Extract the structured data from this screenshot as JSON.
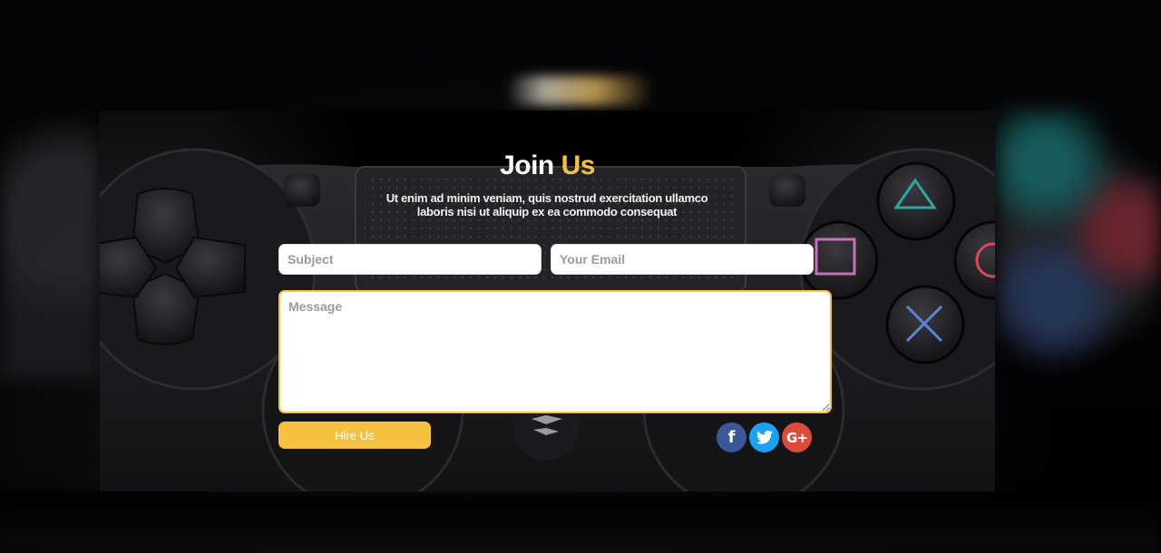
{
  "section": {
    "title_part1": "Join",
    "title_part2": "Us",
    "description": "Ut enim ad minim veniam, quis nostrud exercitation ullamco laboris nisi ut aliquip ex ea commodo consequat"
  },
  "form": {
    "subject_placeholder": "Subject",
    "email_placeholder": "Your Email",
    "message_placeholder": "Message",
    "submit_label": "Hire Us"
  },
  "social": [
    {
      "name": "facebook",
      "icon": "facebook-icon",
      "glyph": "f",
      "color": "#3b5998"
    },
    {
      "name": "twitter",
      "icon": "twitter-icon",
      "color": "#1da1f2"
    },
    {
      "name": "google-plus",
      "icon": "google-plus-icon",
      "glyph": "G+",
      "color": "#dd4b39"
    }
  ],
  "colors": {
    "accent": "#f6c13f",
    "background": "#000000",
    "text": "#ffffff"
  }
}
